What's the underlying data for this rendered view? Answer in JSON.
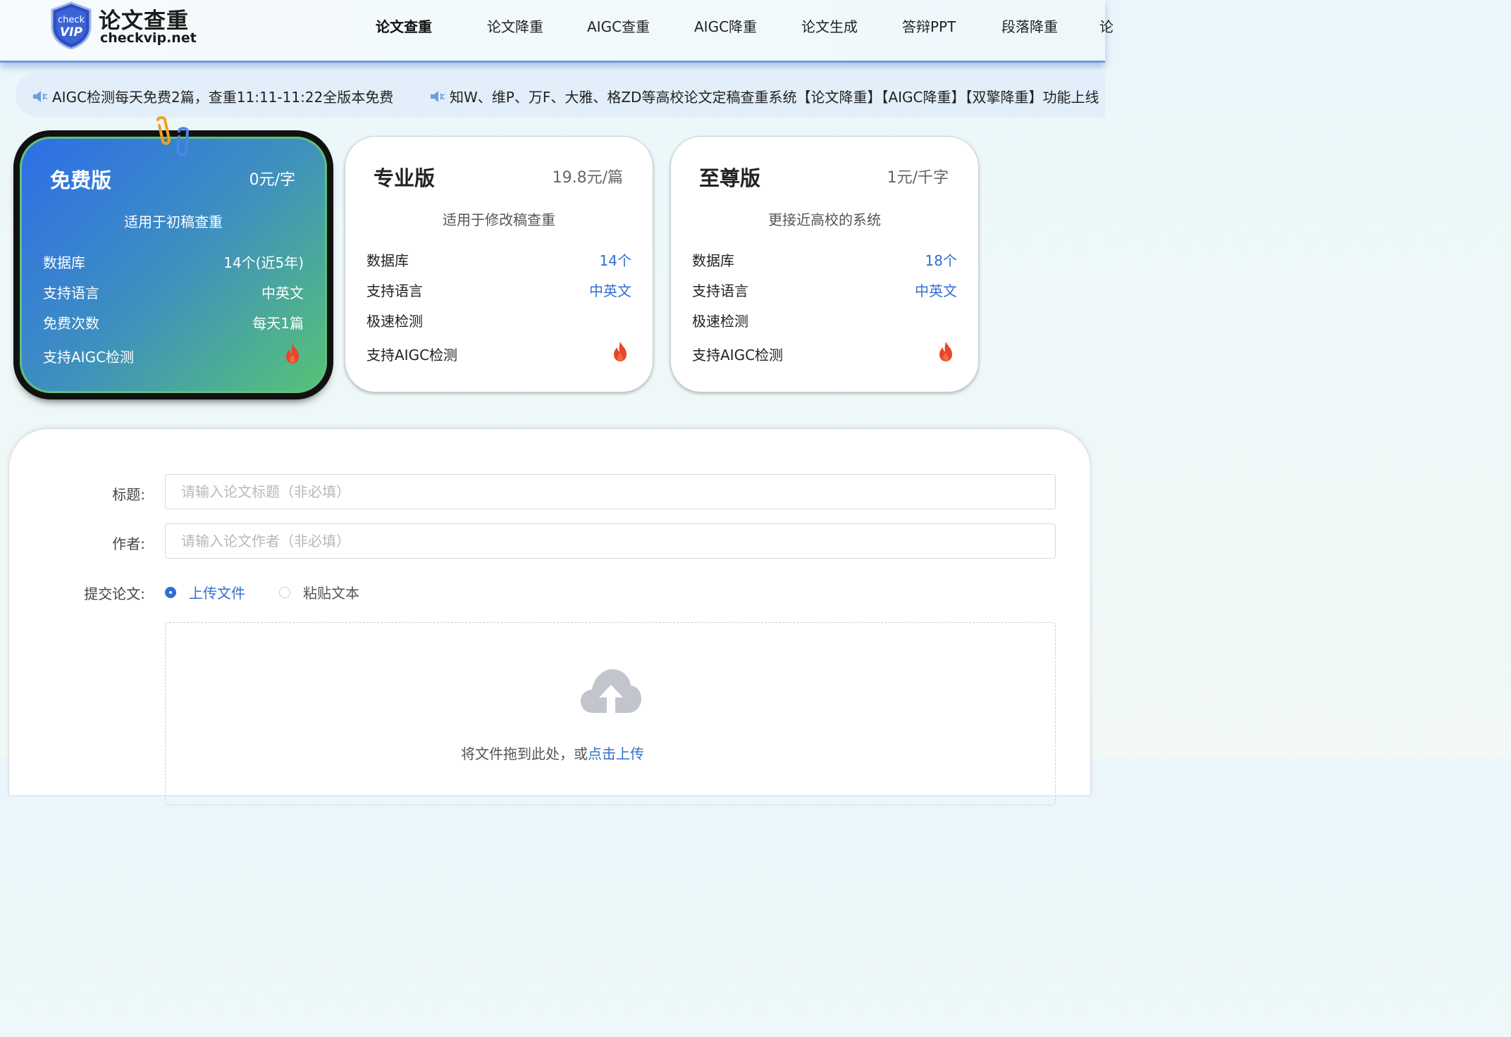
{
  "brand": {
    "title": "论文查重",
    "domain": "checkvip.net",
    "badge_top": "check",
    "badge_bottom": "VIP"
  },
  "nav": [
    {
      "label": "论文查重",
      "active": true
    },
    {
      "label": "论文降重"
    },
    {
      "label": "AIGC查重"
    },
    {
      "label": "AIGC降重"
    },
    {
      "label": "论文生成"
    },
    {
      "label": "答辩PPT"
    },
    {
      "label": "段落降重"
    },
    {
      "label": "论"
    }
  ],
  "notices": [
    "AIGC检测每天免费2篇，查重11:11-11:22全版本免费",
    "知W、维P、万F、大雅、格ZD等高校论文定稿查重系统【论文降重】【AIGC降重】【双擎降重】功能上线"
  ],
  "cards": [
    {
      "name": "免费版",
      "price": "0元/字",
      "subtitle": "适用于初稿查重",
      "rows": [
        {
          "key": "数据库",
          "value": "14个(近5年)"
        },
        {
          "key": "支持语言",
          "value": "中英文"
        },
        {
          "key": "免费次数",
          "value": "每天1篇"
        },
        {
          "key": "支持AIGC检测",
          "value": ""
        }
      ]
    },
    {
      "name": "专业版",
      "price": "19.8元/篇",
      "subtitle": "适用于修改稿查重",
      "rows": [
        {
          "key": "数据库",
          "value": "14个"
        },
        {
          "key": "支持语言",
          "value": "中英文"
        },
        {
          "key": "极速检测",
          "value": ""
        },
        {
          "key": "支持AIGC检测",
          "value": ""
        }
      ]
    },
    {
      "name": "至尊版",
      "price": "1元/千字",
      "subtitle": "更接近高校的系统",
      "rows": [
        {
          "key": "数据库",
          "value": "18个"
        },
        {
          "key": "支持语言",
          "value": "中英文"
        },
        {
          "key": "极速检测",
          "value": ""
        },
        {
          "key": "支持AIGC检测",
          "value": ""
        }
      ]
    }
  ],
  "form": {
    "title_label": "标题:",
    "title_placeholder": "请输入论文标题（非必填）",
    "author_label": "作者:",
    "author_placeholder": "请输入论文作者（非必填）",
    "submit_label": "提交论文:",
    "options": [
      {
        "label": "上传文件",
        "selected": true
      },
      {
        "label": "粘贴文本",
        "selected": false
      }
    ],
    "drop_text": "将文件拖到此处，或",
    "drop_link": "点击上传"
  },
  "colors": {
    "accent": "#2f6fd1",
    "flame": "#e8452c",
    "free_start": "#2d6ee8",
    "free_end": "#58c276"
  },
  "icons": [
    "shield-logo-icon",
    "speaker-icon",
    "flame-icon",
    "paperclip-icon",
    "cloud-upload-icon"
  ]
}
